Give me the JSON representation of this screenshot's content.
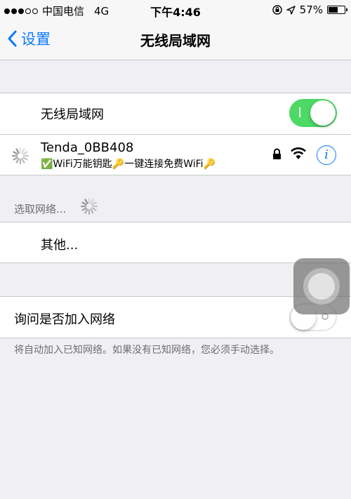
{
  "status_bar": {
    "carrier": "中国电信",
    "network": "4G",
    "time": "下午4:46",
    "battery": "57%",
    "battery_level": 0.57
  },
  "nav": {
    "back_label": "设置",
    "title": "无线局域网"
  },
  "wifi_toggle": {
    "label": "无线局域网",
    "on": true
  },
  "connected_network": {
    "name": "Tenda_0BB408",
    "subtitle": "✅WiFi万能钥匙🔑一键连接免费WiFi🔑"
  },
  "choose_network": {
    "label": "选取网络..."
  },
  "other": {
    "label": "其他..."
  },
  "ask_join": {
    "label": "询问是否加入网络",
    "on": false
  },
  "footer_text": "将自动加入已知网络。如果没有已知网络，您必须手动选择。",
  "colors": {
    "accent": "#0a7aff",
    "toggle_on": "#4cd964",
    "background": "#efeff4"
  },
  "icons": {
    "lock": "lock-icon",
    "wifi": "wifi-icon",
    "info": "info-icon",
    "back": "chevron-left-icon"
  }
}
